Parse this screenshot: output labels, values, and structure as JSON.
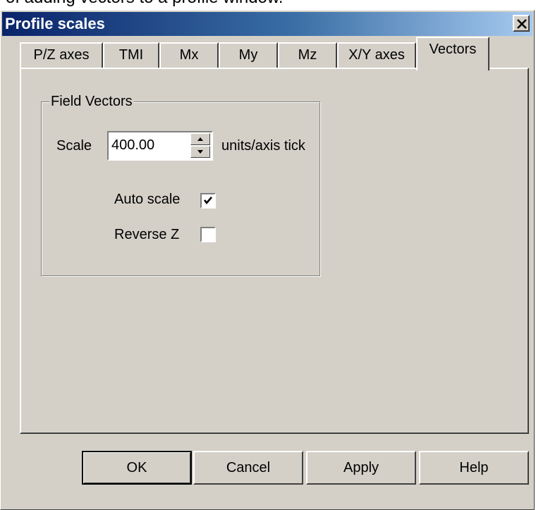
{
  "caption": "of adding vectors to a profile window.",
  "window": {
    "title": "Profile scales",
    "close_icon": "close-icon"
  },
  "tabs": [
    {
      "label": "P/Z axes",
      "active": false
    },
    {
      "label": "TMI",
      "active": false
    },
    {
      "label": "Mx",
      "active": false
    },
    {
      "label": "My",
      "active": false
    },
    {
      "label": "Mz",
      "active": false
    },
    {
      "label": "X/Y axes",
      "active": false
    },
    {
      "label": "Vectors",
      "active": true
    }
  ],
  "field_vectors": {
    "group_label": "Field Vectors",
    "scale_label": "Scale",
    "scale_value": "400.00",
    "units_label": "units/axis tick",
    "auto_scale_label": "Auto scale",
    "auto_scale_checked": true,
    "reverse_z_label": "Reverse Z",
    "reverse_z_checked": false
  },
  "buttons": {
    "ok": "OK",
    "cancel": "Cancel",
    "apply": "Apply",
    "help": "Help"
  }
}
